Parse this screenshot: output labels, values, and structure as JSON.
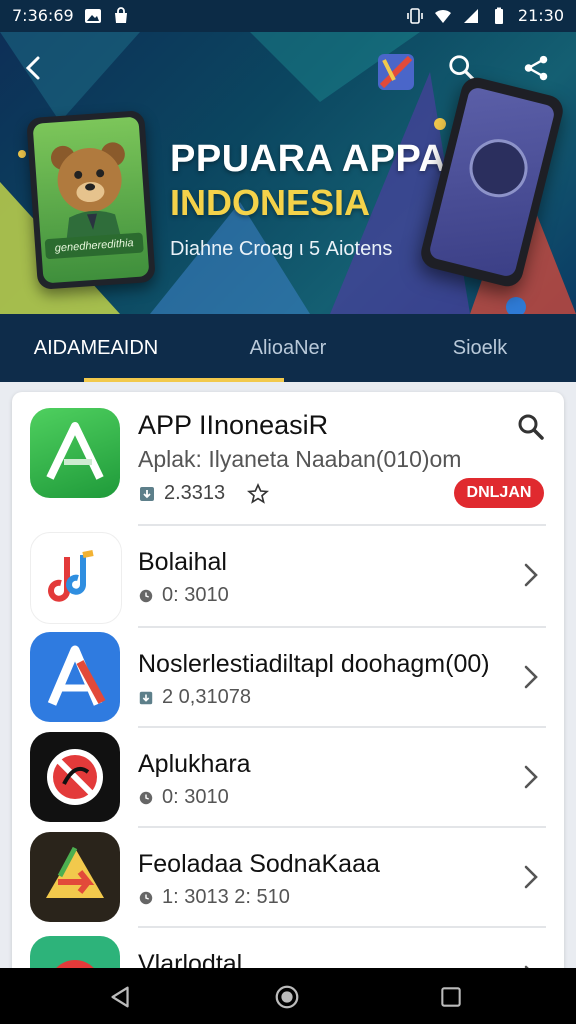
{
  "status_bar": {
    "time": "7:36:69",
    "right_time": "21:30"
  },
  "hero": {
    "title_line1": "PPUARA APPA",
    "title_line2": "INDONESIA",
    "subtitle": "Diahne Croag ι 5 Aiotens",
    "bear_caption": "genedheredithia"
  },
  "tabs": [
    {
      "label": "AIDAMEAIDN",
      "active": true
    },
    {
      "label": "AlioaNer",
      "active": false
    },
    {
      "label": "Sioelk",
      "active": false
    }
  ],
  "featured": {
    "title": "APP IInoneasiR",
    "subtitle": "Aplak: Ilyaneta Naaban(010)om",
    "meta": "2.3313",
    "badge": "DNLJAN",
    "badge_color": "#e02a2f"
  },
  "apps": [
    {
      "title": "Bolaihal",
      "meta": "0: 3010"
    },
    {
      "title": "Noslerlestiadiltapl doohagm(00)",
      "meta": "2 0,31078"
    },
    {
      "title": "Aplukhara",
      "meta": "0: 3010"
    },
    {
      "title": "Feoladaa SodnaKaaa",
      "meta": "1: 3013 2: 510"
    },
    {
      "title": "Vlarlodtal",
      "meta": ""
    }
  ],
  "colors": {
    "header_bg": "#0e2c4a",
    "accent_yellow": "#f2c94c",
    "badge_red": "#e02a2f"
  }
}
